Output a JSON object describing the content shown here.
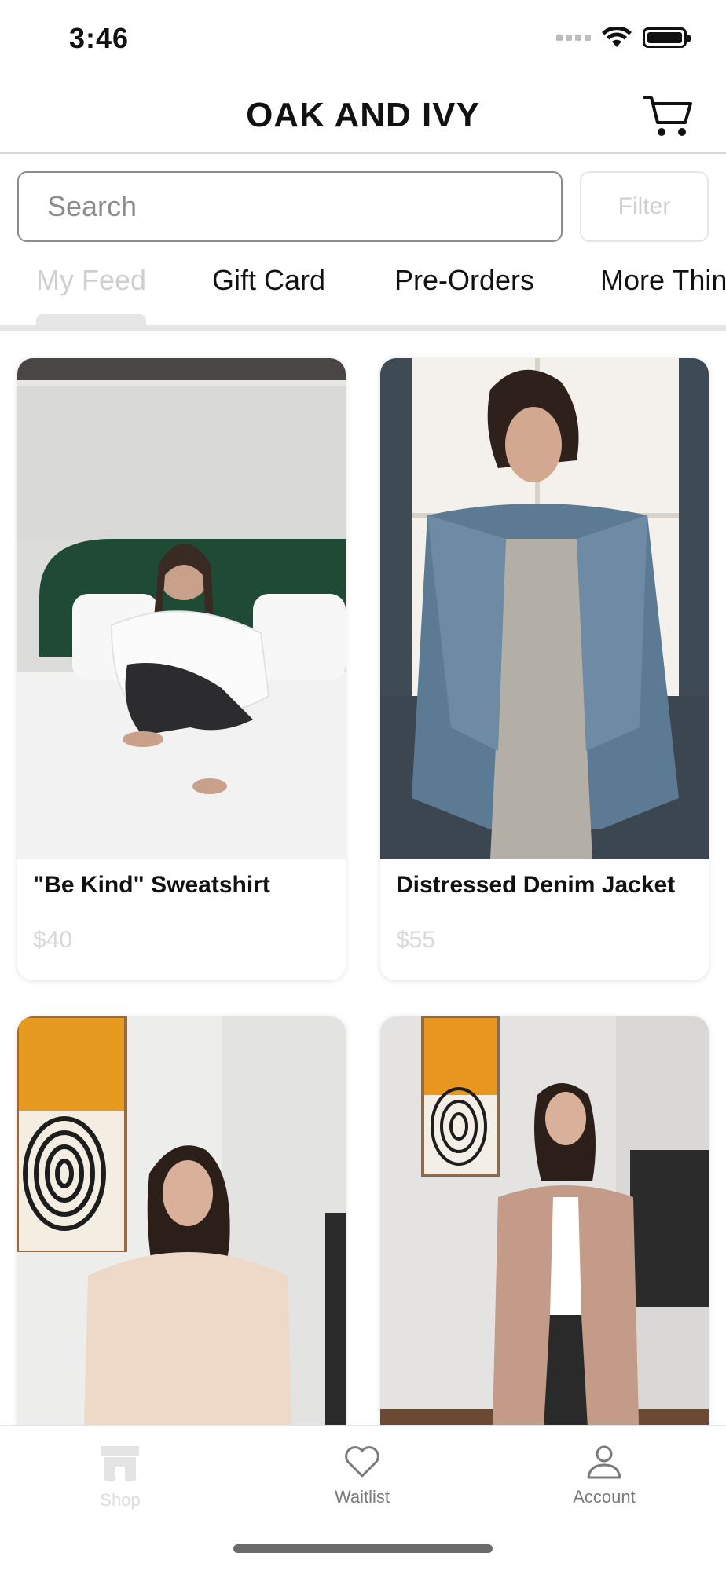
{
  "status_bar": {
    "time": "3:46"
  },
  "header": {
    "title": "OAK AND IVY",
    "cart_icon": "cart-icon"
  },
  "search": {
    "placeholder": "Search",
    "filter_label": "Filter"
  },
  "tabs": [
    {
      "label": "My Feed",
      "active": true
    },
    {
      "label": "Gift Card",
      "active": false
    },
    {
      "label": "Pre-Orders",
      "active": false
    },
    {
      "label": "More Thin",
      "active": false
    }
  ],
  "products": [
    {
      "name": "\"Be Kind\" Sweatshirt",
      "price": "$40"
    },
    {
      "name": "Distressed Denim Jacket",
      "price": "$55"
    },
    {
      "name": "",
      "price": ""
    },
    {
      "name": "",
      "price": ""
    }
  ],
  "nav": [
    {
      "label": "Shop",
      "icon": "storefront-icon",
      "active": true
    },
    {
      "label": "Waitlist",
      "icon": "heart-icon",
      "active": false
    },
    {
      "label": "Account",
      "icon": "person-icon",
      "active": false
    }
  ],
  "colors": {
    "text": "#111111",
    "muted": "#cfcfcf",
    "border": "#8c8c8c",
    "nav_inactive": "#7a7a7a"
  }
}
